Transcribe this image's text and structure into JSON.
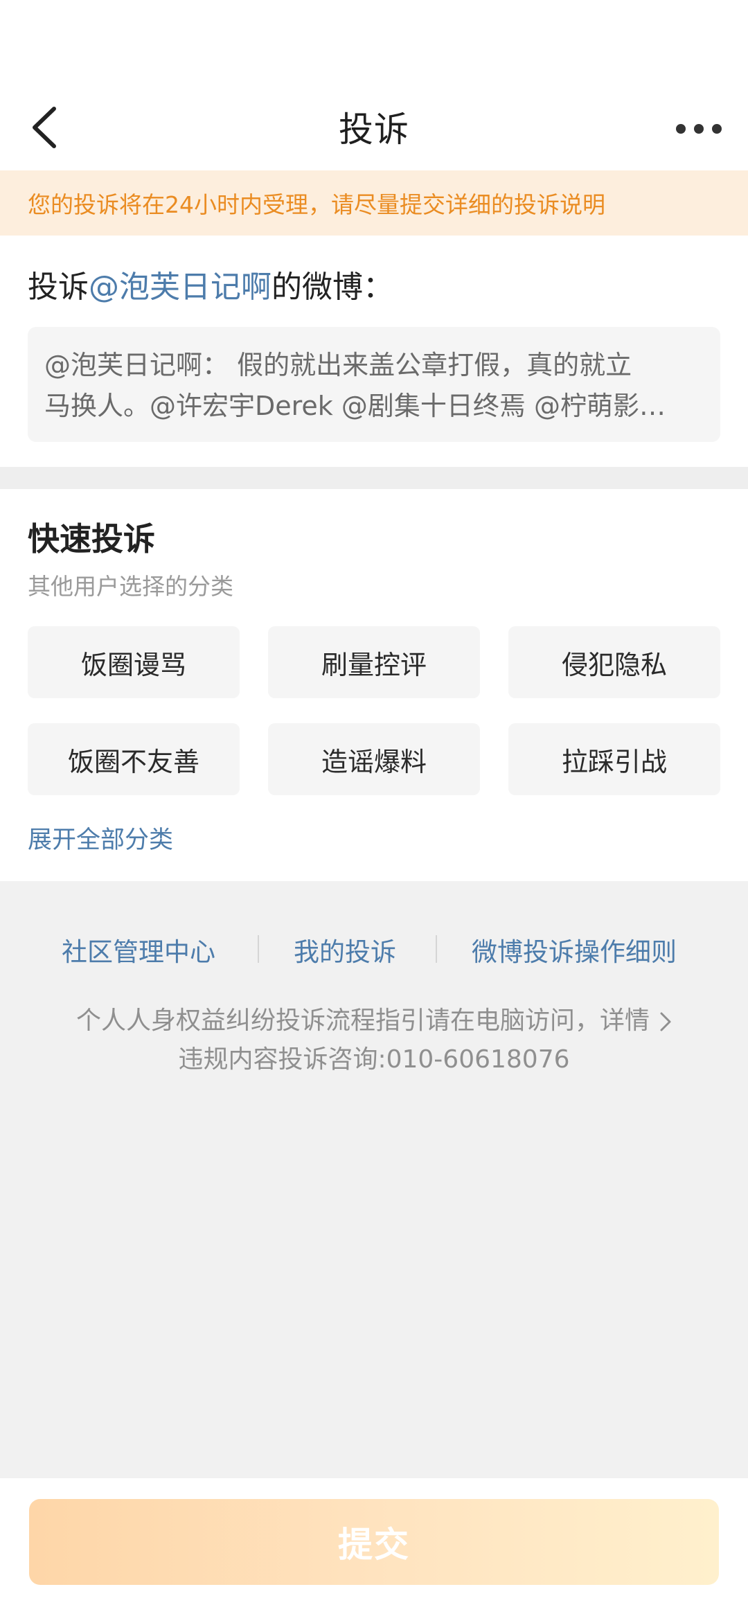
{
  "header": {
    "title": "投诉",
    "back_icon": "chevron-left-icon",
    "more_icon": "more-horizontal-icon"
  },
  "notice": {
    "text": "您的投诉将在24小时内受理，请尽量提交详细的投诉说明",
    "color": "#ea8c22",
    "background": "#fdeedd"
  },
  "target": {
    "prefix": "投诉",
    "user": "@泡芙日记啊",
    "suffix": "的微博：",
    "quote_line1": "@泡芙日记啊：  假的就出来盖公章打假，真的就立",
    "quote_line2": "马换人。@许宏宇Derek @剧集十日终焉 @柠萌影…"
  },
  "quick": {
    "title": "快速投诉",
    "subtitle": "其他用户选择的分类",
    "categories": [
      "饭圈谩骂",
      "刷量控评",
      "侵犯隐私",
      "饭圈不友善",
      "造谣爆料",
      "拉踩引战"
    ],
    "expand_label": "展开全部分类"
  },
  "footer": {
    "links": [
      "社区管理中心",
      "我的投诉",
      "微博投诉操作细则"
    ],
    "guide_text": "个人人身权益纠纷投诉流程指引请在电脑访问，详情",
    "consult_text": "违规内容投诉咨询:010-60618076"
  },
  "submit": {
    "label": "提交"
  },
  "colors": {
    "link": "#4d7cab",
    "submit_gradient_start": "#fed6a8",
    "submit_gradient_end": "#fff0cd"
  }
}
